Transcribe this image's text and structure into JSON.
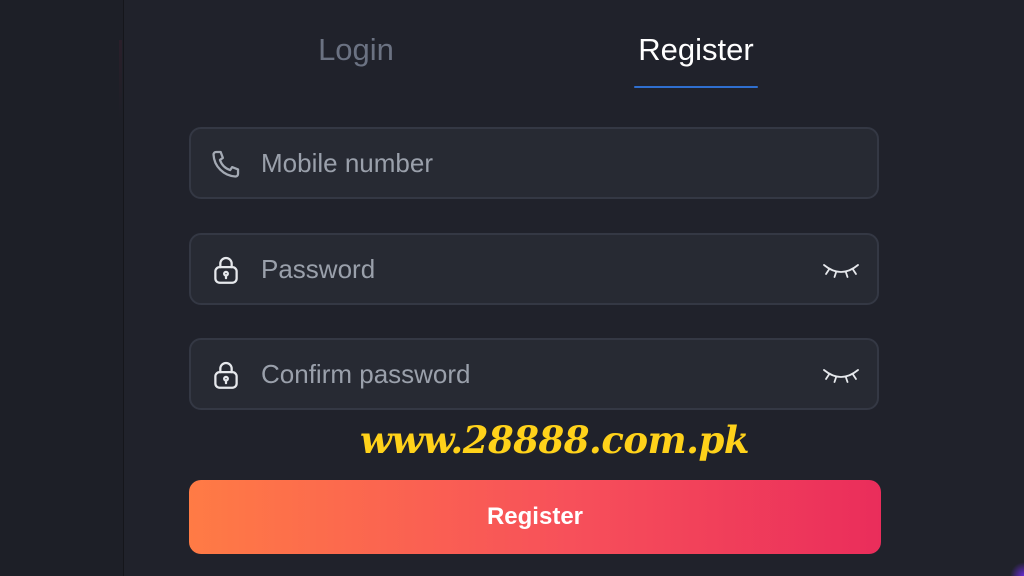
{
  "tabs": {
    "login_label": "Login",
    "register_label": "Register",
    "active": "Register"
  },
  "form": {
    "mobile": {
      "placeholder": "Mobile number",
      "value": "",
      "icon": "phone-icon"
    },
    "password": {
      "placeholder": "Password",
      "value": "",
      "icon": "lock-icon",
      "toggle_icon": "eye-closed-icon"
    },
    "confirm_password": {
      "placeholder": "Confirm password",
      "value": "",
      "icon": "lock-icon",
      "toggle_icon": "eye-closed-icon"
    },
    "submit_label": "Register"
  },
  "watermark": "www.28888.com.pk",
  "colors": {
    "background": "#20222b",
    "active_tab_underline": "#2f6fcf",
    "button_gradient_start": "#ff7b45",
    "button_gradient_end": "#ea2d5b",
    "watermark": "#ffd21a"
  }
}
